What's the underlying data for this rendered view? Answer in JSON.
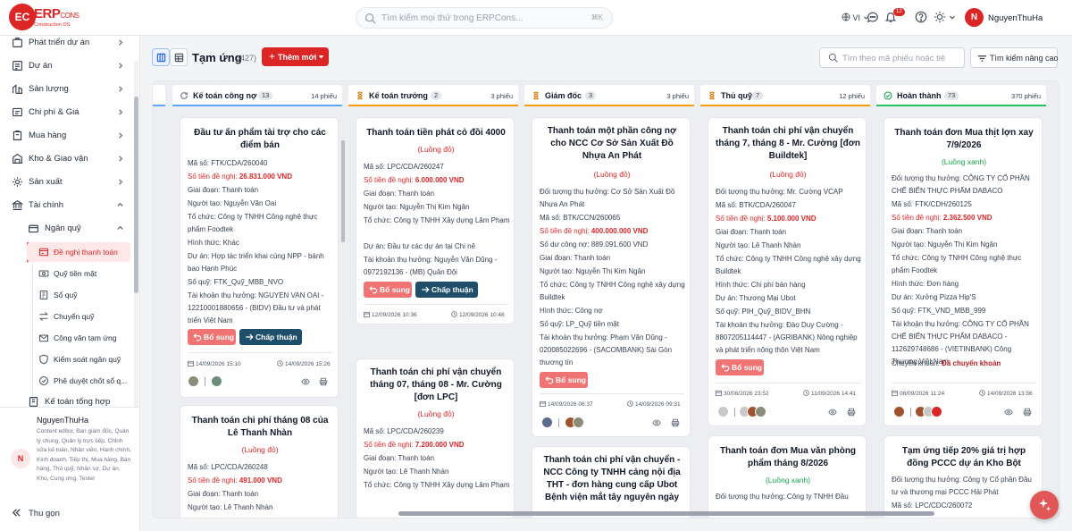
{
  "app": {
    "logo_main": "ERP",
    "logo_main_small": "CONS",
    "logo_sub": "Construction OS",
    "search_placeholder": "Tìm kiếm mọi thứ trong ERPCons...",
    "search_shortcut": "⌘K",
    "language": "VI",
    "notification_count": "12",
    "user_initial": "N",
    "user_name": "NguyenThuHa",
    "brand_color": "#dc2626"
  },
  "sidebar": {
    "items": [
      {
        "label": "Phát triển dự án",
        "icon": "project-dev-icon"
      },
      {
        "label": "Dự án",
        "icon": "project-icon"
      },
      {
        "label": "Sản lượng",
        "icon": "output-icon"
      },
      {
        "label": "Chi phí & Giá",
        "icon": "cost-icon"
      },
      {
        "label": "Mua hàng",
        "icon": "purchase-icon"
      },
      {
        "label": "Kho & Giao vận",
        "icon": "warehouse-icon"
      },
      {
        "label": "Sản xuất",
        "icon": "production-icon"
      },
      {
        "label": "Tài chính",
        "icon": "finance-icon"
      }
    ],
    "finance_sub": {
      "group_label": "Ngân quỹ",
      "items": [
        {
          "label": "Đề nghị thanh toán",
          "active": true
        },
        {
          "label": "Quỹ tiền mặt"
        },
        {
          "label": "Sổ quỹ"
        },
        {
          "label": "Chuyển quỹ"
        },
        {
          "label": "Công văn tạm ứng"
        },
        {
          "label": "Kiểm soát ngân quỹ"
        },
        {
          "label": "Phê duyệt chốt sổ q..."
        }
      ],
      "next_group": "Kế toán tổng hợp"
    },
    "profile": {
      "initial": "N",
      "name": "NguyenThuHa",
      "roles": "Content editor, Ban giám đốc, Quản lý chung, Quản lý trực tiếp, Chỉnh sửa kế toán, Nhân viên, Hành chính, Kinh doanh, Tiếp thị, Mua hàng, Bán hàng, Thủ quỹ, Nhân sự, Dự án, Kho, Cung ứng, Tester"
    },
    "collapse_label": "Thu gọn"
  },
  "toolbar": {
    "title": "Tạm ứng",
    "count": "(427)",
    "new_label": "Thêm mới",
    "filter_placeholder": "Tìm theo mã phiếu hoặc tiê",
    "advanced_label": "Tìm kiếm nâng cao"
  },
  "columns": [
    {
      "name": "Kế toán công nợ",
      "count": "13",
      "total": "14 phiếu",
      "cards": [
        {
          "title": "Đầu tư ấn phẩm tài trợ cho các điểm bán",
          "lines": [
            "Mã số: FTK/CDA/260040",
            "Số tiền đề nghị: ",
            "Giai đoạn: Thanh toán",
            "Người tạo: Nguyễn Văn Oai",
            "Tổ chức: Công ty TNHH Công nghệ thực phẩm Foodtek",
            "Hình thức: Khác",
            "Dự án: Hợp tác triển khai cùng NPP - bánh bao Hạnh Phúc",
            "Số quỹ: FTK_Quỹ_MBB_NVO",
            "Tài khoản thụ hưởng: NGUYEN VAN OAI - 12210001880656 - (BIDV) Đầu tư và phát triển Việt Nam"
          ],
          "amount": "26.831.000 VND",
          "support": "Bổ sung",
          "approve": "Chấp thuận",
          "date_left": "14/09/2026 15:10",
          "date_right": "14/09/2026 15:26"
        },
        {
          "title": "Thanh toán chi phí tháng 08 của Lê Thanh Nhàn",
          "flow": "(Luồng đỏ)",
          "lines": [
            "Mã số: LPC/CDA/260248",
            "Số tiền đề nghị: ",
            "Giai đoạn: Thanh toán",
            "Người tạo: Lê Thanh Nhàn"
          ],
          "amount": "491.000 VND"
        }
      ]
    },
    {
      "name": "Kế toán trưởng",
      "count": "2",
      "total": "3 phiếu",
      "cards": [
        {
          "title": "Thanh toán tiền phát cỏ đồi 4000",
          "flow": "(Luồng đỏ)",
          "lines": [
            "Mã số: LPC/CDA/260247",
            "Số tiền đề nghị: ",
            "Giai đoạn: Thanh toán",
            "Người tạo: Nguyễn Thị Kim Ngân",
            "Tổ chức: Công ty TNHH Xây dựng Lâm Phạm",
            "Dự án: Đầu tư các dự án tại Chi nê",
            "Tài khoản thụ hưởng: Nguyễn Văn Dũng - 0972192136 - (MB) Quân Đội"
          ],
          "amount": "6.000.000 VND",
          "support": "Bổ sung",
          "approve": "Chấp thuận",
          "date_left": "12/09/2026 10:36",
          "date_right": "12/09/2026 10:48"
        },
        {
          "title": "Thanh toán chi phí vận chuyển tháng 07, tháng 08 - Mr. Cường [đơn LPC]",
          "flow": "(Luồng đỏ)",
          "lines": [
            "Mã số: LPC/CDA/260239",
            "Số tiền đề nghị: ",
            "Giai đoạn: Thanh toán",
            "Người tạo: Lê Thanh Nhàn",
            "Tổ chức: Công ty TNHH Xây dựng Lâm Phạm"
          ],
          "amount": "7.200.000 VND"
        }
      ]
    },
    {
      "name": "Giám đốc",
      "count": "3",
      "total": "3 phiếu",
      "cards": [
        {
          "title": "Thanh toán một phần công nợ cho NCC Cơ Sở Sản Xuất Đồ Nhựa An Phát",
          "flow": "(Luồng đỏ)",
          "lines": [
            "Đối tượng thụ hưởng: Cơ Sở Sản Xuất Đồ Nhựa An Phát",
            "Mã số: BTK/CCN/260065",
            "Số tiền đề nghị: ",
            "Số dư công nợ: 889.091.600 VND",
            "Giai đoạn: Thanh toán",
            "Người tạo: Nguyễn Thị Kim Ngân",
            "Tổ chức: Công ty TNHH Công nghệ xây dựng Buildtek",
            "Hình thức: Công nợ",
            "Số quỹ: LP_Quỹ tiền mặt",
            "Tài khoản thụ hưởng: Phạm Văn Dũng - 020085022696 - (SACOMBANK) Sài Gòn thương tín"
          ],
          "amount": "400.000.000 VND",
          "support": "Bổ sung",
          "date_left": "14/09/2026 06:37",
          "date_right": "14/09/2026 09:31"
        },
        {
          "title": "Thanh toán chi phí vận chuyển - NCC Công ty TNHH cảng nội địa THT - đơn hàng cung cấp Ubot Bệnh viện mắt tây nguyên ngày"
        }
      ]
    },
    {
      "name": "Thủ quỹ",
      "count": "7",
      "total": "12 phiếu",
      "cards": [
        {
          "title": "Thanh toán chi phí vận chuyển tháng 7, tháng 8 - Mr. Cường [đơn Buildtek]",
          "flow": "(Luồng đỏ)",
          "lines": [
            "Đối tượng thụ hưởng: Mr. Cường VCAP",
            "Mã số: BTK/CDA/260047",
            "Số tiền đề nghị: ",
            "Giai đoạn: Thanh toán",
            "Người tạo: Lê Thanh Nhàn",
            "Tổ chức: Công ty TNHH Công nghệ xây dựng Buildtek",
            "Hình thức: Chi phí bán hàng",
            "Dự án: Thương Mại Ubot",
            "Số quỹ: PIH_Quỹ_BIDV_BHN",
            "Tài khoản thụ hưởng: Đào Duy Cường - 8807205114447 - (AGRIBANK) Nông nghiệp và phát triển nông thôn Việt Nam"
          ],
          "amount": "5.100.000 VND",
          "support": "Bổ sung",
          "date_left": "30/08/2026 23:52",
          "date_right": "11/09/2026 14:41"
        },
        {
          "title": "Thanh toán đơn Mua văn phòng phẩm tháng 8/2026",
          "flow": "(Luồng xanh)",
          "lines": [
            "Đối tượng thụ hưởng: Công ty TNHH Đầu"
          ]
        }
      ]
    },
    {
      "name": "Hoàn thành",
      "count": "73",
      "total": "370 phiếu",
      "cards": [
        {
          "title": "Thanh toán đơn Mua thịt lợn xay 7/9/2026",
          "flow": "(Luồng xanh)",
          "lines": [
            "Đối tượng thụ hưởng: CÔNG TY CỔ PHẦN CHẾ BIẾN THỰC PHẨM DABACO",
            "Mã số: FTK/CDH/260125",
            "Số tiền đề nghị: ",
            "Giai đoạn: Thanh toán",
            "Người tạo: Nguyễn Thị Kim Ngân",
            "Tổ chức: Công ty TNHH Công nghệ thực phẩm Foodtek",
            "Hình thức: Đơn hàng",
            "Dự án: Xưởng Pizza Hip'S",
            "Số quỹ: FTK_VND_MBB_999",
            "Tài khoản thụ hưởng: CÔNG TY CỔ PHẦN CHẾ BIẾN THỰC PHẨM DABACO - 112629748686 - (VIETINBANK) Công Thương Việt Nam",
            "Chuyển khoản: "
          ],
          "amount": "2.362.500 VND",
          "transfer": "Đã chuyển khoản",
          "date_left": "08/09/2026 11:24",
          "date_right": "14/09/2026 13:56"
        },
        {
          "title": "Tạm ứng tiếp 20% giá trị hợp đồng PCCC dự án Kho Bột",
          "lines": [
            "Đối tượng thụ hưởng: Công ty Cổ phần Đầu tư và thương mại PCCC Hải Phát",
            "Mã số: LPC/CDC/260072"
          ]
        }
      ]
    }
  ]
}
